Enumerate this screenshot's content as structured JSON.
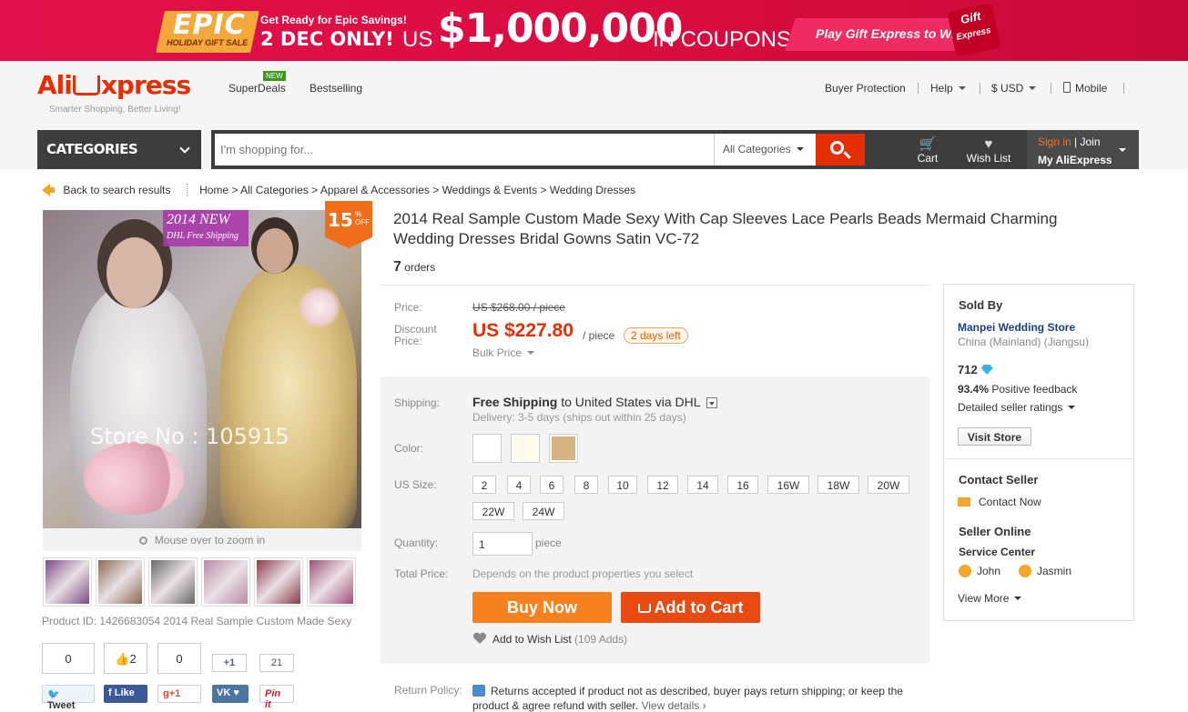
{
  "promo": {
    "epic": "EPIC",
    "holiday": "HOLIDAY GIFT SALE",
    "ready": "Get Ready for Epic Savings!",
    "date": "2 DEC ONLY!",
    "us": "US",
    "amount": "$1,000,000",
    "coupons": "IN COUPONS!",
    "play": "Play Gift Express to Win >",
    "gift": "Gift",
    "gift_express": "Express"
  },
  "header": {
    "logo_left": "Ali",
    "logo_right": "xpress",
    "tagline": "Smarter Shopping, Better Living!",
    "nav": {
      "superdeals": "SuperDeals",
      "new_badge": "NEW",
      "bestselling": "Bestselling"
    },
    "right_nav": {
      "buyer_protection": "Buyer Protection",
      "help": "Help",
      "currency": "$ USD",
      "mobile": "Mobile"
    },
    "categories_label": "CATEGORIES",
    "search_placeholder": "I'm shopping for...",
    "search_category": "All Categories",
    "cart": "Cart",
    "wishlist": "Wish List",
    "sign_in": "Sign in",
    "join": " | Join",
    "my_aliexpress": "My AliExpress"
  },
  "breadcrumb": {
    "back": "Back to search results",
    "path": "Home > All Categories > Apparel & Accessories > Weddings & Events > Wedding Dresses"
  },
  "gallery": {
    "new_tag": "2014 NEW",
    "shipping_tag": "DHL Free Shipping",
    "discount_num": "15",
    "discount_pct": "%",
    "discount_off": "OFF",
    "watermark": "Store No : 105915",
    "zoom_hint": "Mouse over to zoom in",
    "thumb_colors": [
      "#7a4a86",
      "#8a6a52",
      "#6a6a6a",
      "#b88aa6",
      "#8a3a4a",
      "#a0507a"
    ],
    "product_id": "Product ID: 1426683054 2014 Real Sample Custom Made Sexy"
  },
  "social": {
    "tweet_count": "0",
    "tweet": "Tweet",
    "like_count": "2",
    "like": "Like",
    "gplus_count": "0",
    "gplus": "g+1",
    "vk_count": "+1",
    "vk": "VK",
    "pin_count": "21",
    "pin": "Pin it"
  },
  "product": {
    "title": "2014 Real Sample Custom Made Sexy With Cap Sleeves Lace Pearls Beads Mermaid Charming Wedding Dresses Bridal Gowns Satin VC-72",
    "orders_count": "7",
    "orders_label": "orders",
    "price_label": "Price:",
    "old_price": "US $268.00 / piece",
    "discount_label_1": "Discount",
    "discount_label_2": "Price:",
    "price": "US $227.80",
    "per": "/ piece",
    "days_left": "2 days left",
    "bulk": "Bulk Price",
    "shipping_label": "Shipping:",
    "free_shipping": "Free Shipping",
    "ship_to": " to  United States via DHL",
    "delivery": "Delivery: 3-5 days (ships out within 25 days)",
    "color_label": "Color:",
    "colors": [
      "#ffffff",
      "#fffbe6",
      "#d6b483"
    ],
    "size_label": "US Size:",
    "sizes": [
      "2",
      "4",
      "6",
      "8",
      "10",
      "12",
      "14",
      "16",
      "16W",
      "18W",
      "20W",
      "22W",
      "24W"
    ],
    "quantity_label": "Quantity:",
    "quantity": "1",
    "piece": "piece",
    "total_label": "Total Price:",
    "total": "Depends on the product properties you select",
    "buy_now": "Buy Now",
    "add_to_cart": "Add to Cart",
    "wish": "Add to Wish List",
    "wish_adds": " (109 Adds)",
    "return_label": "Return Policy:",
    "return_text": "Returns accepted if product not as described, buyer pays return shipping; or keep the product & agree refund with seller.",
    "view_details": "View details ›"
  },
  "seller": {
    "sold_by": "Sold By",
    "store": "Manpei Wedding Store",
    "location": "China (Mainland) (Jiangsu)",
    "score": "712",
    "feedback_pct": "93.4%",
    "feedback_label": " Positive feedback",
    "ratings": "Detailed seller ratings",
    "visit": "Visit Store",
    "contact_title": "Contact Seller",
    "contact_now": "Contact Now",
    "online_title": "Seller Online",
    "service": "Service Center",
    "agents": [
      "John",
      "Jasmin"
    ],
    "view_more": "View More"
  },
  "colors": {
    "accent": "#e62e04",
    "orange": "#f7811d",
    "banner": "#e2104a"
  }
}
